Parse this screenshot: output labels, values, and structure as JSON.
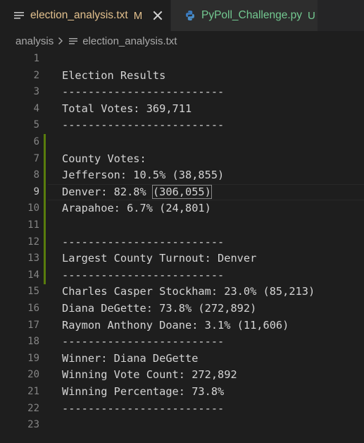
{
  "tabs": [
    {
      "label": "election_analysis.txt",
      "badge": "M",
      "active": true
    },
    {
      "label": "PyPoll_Challenge.py",
      "badge": "U",
      "active": false
    }
  ],
  "breadcrumb": {
    "folder": "analysis",
    "file": "election_analysis.txt"
  },
  "editor": {
    "current_line": 9,
    "lines": [
      "",
      "Election Results",
      "-------------------------",
      "Total Votes: 369,711",
      "-------------------------",
      "",
      "County Votes:",
      "Jefferson: 10.5% (38,855)",
      "Denver: 82.8% (306,055)",
      "Arapahoe: 6.7% (24,801)",
      "",
      "-------------------------",
      "Largest County Turnout: Denver",
      "-------------------------",
      "Charles Casper Stockham: 23.0% (85,213)",
      "Diana DeGette: 73.8% (272,892)",
      "Raymon Anthony Doane: 3.1% (11,606)",
      "-------------------------",
      "Winner: Diana DeGette",
      "Winning Vote Count: 272,892",
      "Winning Percentage: 73.8%",
      "-------------------------",
      ""
    ],
    "line_numbers": [
      "1",
      "2",
      "3",
      "4",
      "5",
      "6",
      "7",
      "8",
      "9",
      "10",
      "11",
      "12",
      "13",
      "14",
      "15",
      "16",
      "17",
      "18",
      "19",
      "20",
      "21",
      "22",
      "23"
    ],
    "denver_line": {
      "prefix": "Denver: 82.8% ",
      "bracketed": "(306,055)"
    }
  },
  "colors": {
    "modified": "#e2c08d",
    "untracked": "#73c991",
    "python_icon": "#3b7bbf",
    "gutter_added": "#587c0c"
  },
  "icons": {
    "text_file": "text-file-icon",
    "python": "python-icon",
    "close": "close-icon",
    "chevron": "chevron-right-icon"
  }
}
